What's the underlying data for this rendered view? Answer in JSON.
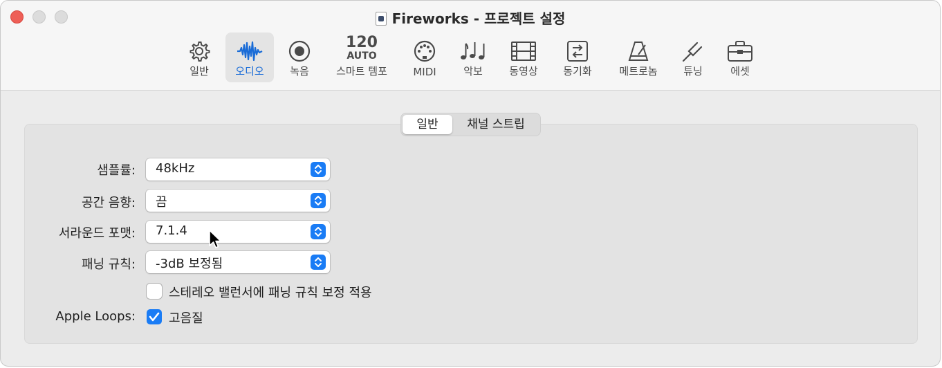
{
  "window": {
    "title": "Fireworks - 프로젝트 설정",
    "colors": {
      "accent": "#1a6cd7",
      "close": "#ee5f57"
    }
  },
  "toolbar": {
    "items": [
      {
        "label": "일반",
        "icon": "gear-icon"
      },
      {
        "label": "오디오",
        "icon": "waveform-icon",
        "selected": true
      },
      {
        "label": "녹음",
        "icon": "record-icon"
      },
      {
        "label": "스마트 템포",
        "icon": "tempo-icon",
        "icon_text_top": "120",
        "icon_text_bottom": "AUTO"
      },
      {
        "label": "MIDI",
        "icon": "midi-port-icon"
      },
      {
        "label": "악보",
        "icon": "music-notes-icon"
      },
      {
        "label": "동영상",
        "icon": "film-icon"
      },
      {
        "label": "동기화",
        "icon": "sync-icon"
      },
      {
        "label": "메트로놈",
        "icon": "metronome-icon"
      },
      {
        "label": "튜닝",
        "icon": "tuning-fork-icon"
      },
      {
        "label": "에셋",
        "icon": "briefcase-icon"
      }
    ]
  },
  "tabs": [
    {
      "label": "일반",
      "active": true
    },
    {
      "label": "채널 스트립",
      "active": false
    }
  ],
  "settings": {
    "sample_rate": {
      "label": "샘플률:",
      "value": "48kHz"
    },
    "spatial_audio": {
      "label": "공간 음향:",
      "value": "끔"
    },
    "surround_format": {
      "label": "서라운드 포맷:",
      "value": "7.1.4"
    },
    "pan_law": {
      "label": "패닝 규칙:",
      "value": "-3dB 보정됨"
    },
    "stereo_balancer": {
      "label": "스테레오 밸런서에 패닝 규칙 보정 적용",
      "checked": false
    },
    "apple_loops": {
      "label": "Apple Loops:",
      "option_label": "고음질",
      "checked": true
    }
  }
}
